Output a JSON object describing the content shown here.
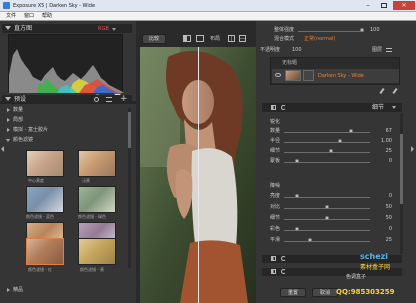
{
  "window": {
    "title": "Exposure X5 | Darken Sky - Wide",
    "controls": [
      "minimize",
      "maximize",
      "close"
    ]
  },
  "menu": [
    "文件",
    "窗口",
    "帮助"
  ],
  "histogram": {
    "title": "直方图",
    "mode": "RGB",
    "badge": "B"
  },
  "presets": {
    "title": "预设",
    "categories": [
      "数量",
      "局部",
      "模拟 - 富士胶片",
      "颜色滤镜"
    ],
    "expanded": "颜色滤镜",
    "thumbs": [
      {
        "label": "中心黄度"
      },
      {
        "label": "泛黄"
      },
      {
        "label": "颜色滤镜 - 蓝色"
      },
      {
        "label": "颜色滤镜 - 绿色"
      },
      {
        "label": "颜色滤镜 - 橙色"
      },
      {
        "label": "颜色滤镜 - 紫色"
      },
      {
        "label": "颜色滤镜 - 红"
      },
      {
        "label": "颜色滤镜 - 黄"
      }
    ],
    "footer": "精品"
  },
  "toolbar": {
    "compare": "比较",
    "layout": "布局"
  },
  "right": {
    "overall_opacity": {
      "label": "整体强度",
      "value": "100"
    },
    "blend_mode": {
      "label": "混合模式",
      "value": "正常(normal)"
    },
    "opacity": {
      "label": "不透明度",
      "value": "100"
    },
    "layers_title": "图层",
    "layers": [
      {
        "name": "无标题"
      },
      {
        "name": "Darken Sky - Wide",
        "active": true
      }
    ],
    "adjust_title": "细节",
    "sharpen": {
      "title": "锐化",
      "rows": [
        {
          "label": "数量",
          "value": "67",
          "pos": 0.78
        },
        {
          "label": "半径",
          "value": "1.00",
          "pos": 0.65
        },
        {
          "label": "细节",
          "value": "25",
          "pos": 0.55
        },
        {
          "label": "蒙板",
          "value": "0",
          "pos": 0.15
        }
      ]
    },
    "noise": {
      "title": "降噪",
      "rows": [
        {
          "label": "亮度",
          "value": "0",
          "pos": 0.15
        },
        {
          "label": "对比",
          "value": "50",
          "pos": 0.5
        },
        {
          "label": "细节",
          "value": "50",
          "pos": 0.5
        },
        {
          "label": "彩色",
          "value": "0",
          "pos": 0.15
        },
        {
          "label": "平滑",
          "value": "25",
          "pos": 0.3
        }
      ]
    },
    "buttons": {
      "reset": "重置",
      "cancel": "取消"
    }
  },
  "watermark": {
    "site": "schezi",
    "cn": "素材盒子网",
    "cn2": "色调盒子",
    "qq": "QQ:985303259"
  },
  "colors": {
    "accent": "#e8823a",
    "panel": "#353535",
    "dark": "#262626"
  }
}
